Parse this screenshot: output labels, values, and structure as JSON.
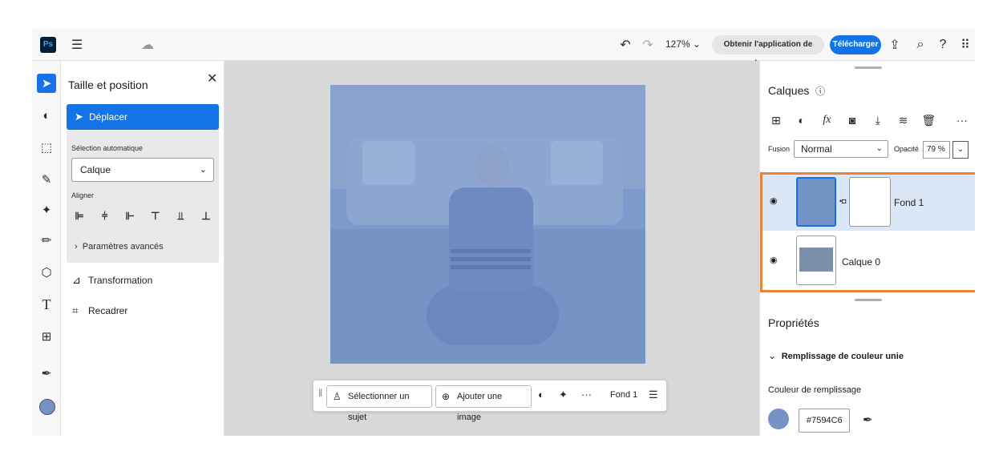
{
  "app": {
    "logo": "Ps"
  },
  "topbar": {
    "menu_icon": "hamburger-icon",
    "cloud_icon": "cloud-icon",
    "zoom": "127%",
    "get_app": "Obtenir l'application de bureau",
    "download": "Télécharger",
    "accent": "#1473e6"
  },
  "left_panel": {
    "title": "Taille et position",
    "move_label": "Déplacer",
    "auto_select_label": "Sélection automatique",
    "auto_select_value": "Calque",
    "align_label": "Aligner",
    "advanced": "Paramètres avancés",
    "transform": "Transformation",
    "crop": "Recadrer"
  },
  "context_bar": {
    "select_subject": "Sélectionner un sujet",
    "add_image": "Ajouter une image",
    "more": "···",
    "layer_name": "Fond 1"
  },
  "layers": {
    "title": "Calques",
    "fusion_label": "Fusion",
    "fusion_value": "Normal",
    "opacity_label": "Opacité",
    "opacity_value": "79 %",
    "more": "···",
    "items": [
      {
        "name": "Fond 1"
      },
      {
        "name": "Calque 0"
      }
    ]
  },
  "properties": {
    "title": "Propriétés",
    "section": "Remplissage de couleur unie",
    "fill_label": "Couleur de remplissage",
    "fill_hex": "#7594C6"
  },
  "colors": {
    "fill": "#7594c6",
    "highlight_frame": "#e8833a"
  }
}
